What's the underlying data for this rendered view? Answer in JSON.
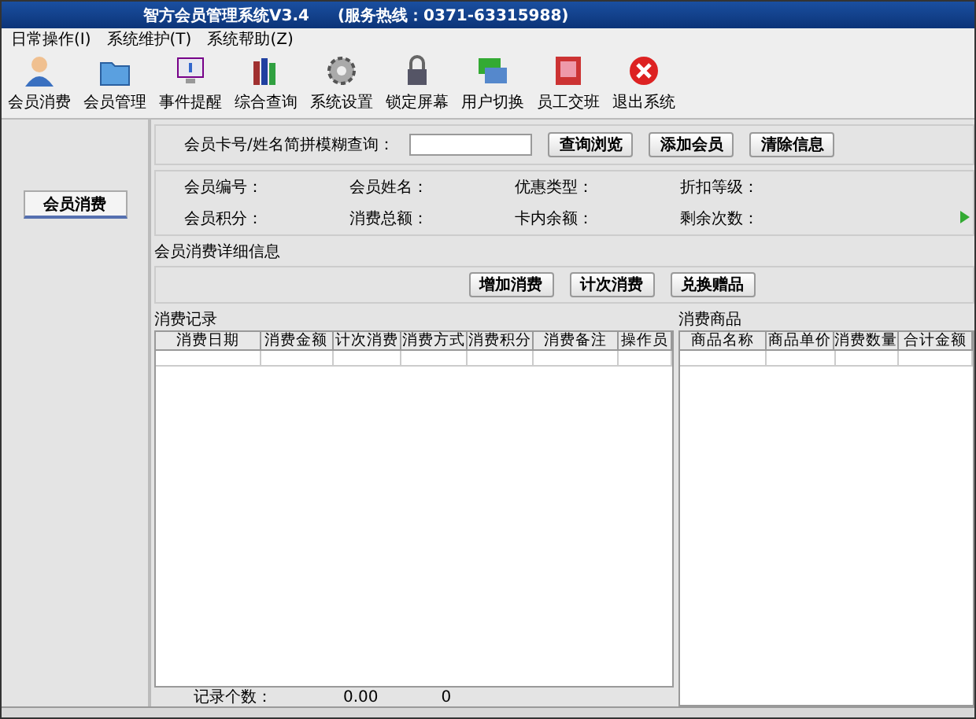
{
  "window": {
    "title": "智方会员管理系统V3.4",
    "hotline": "(服务热线：0371-63315988)"
  },
  "menu": [
    "日常操作(I)",
    "系统维护(T)",
    "系统帮助(Z)"
  ],
  "toolbar": [
    "会员消费",
    "会员管理",
    "事件提醒",
    "综合查询",
    "系统设置",
    "锁定屏幕",
    "用户切换",
    "员工交班",
    "退出系统"
  ],
  "sidebar": {
    "button": "会员消费"
  },
  "search": {
    "label": "会员卡号/姓名简拼模糊查询：",
    "buttons": [
      "查询浏览",
      "添加会员",
      "清除信息"
    ]
  },
  "info_fields": [
    "会员编号：",
    "会员姓名：",
    "优惠类型：",
    "折扣等级：",
    "会员积分：",
    "消费总额：",
    "卡内余额：",
    "剩余次数："
  ],
  "detail_section": {
    "title": "会员消费详细信息",
    "buttons": [
      "增加消费",
      "计次消费",
      "兑换赠品"
    ]
  },
  "records": {
    "title": "消费记录",
    "columns": [
      "消费日期",
      "消费金额",
      "计次消费",
      "消费方式",
      "消费积分",
      "消费备注",
      "操作员"
    ]
  },
  "products": {
    "title": "消费商品",
    "columns": [
      "商品名称",
      "商品单价",
      "消费数量",
      "合计金额"
    ]
  },
  "summary": [
    "记录个数：",
    "0.00",
    "0"
  ]
}
